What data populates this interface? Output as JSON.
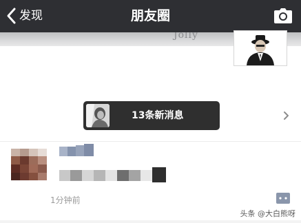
{
  "navbar": {
    "back_label": "发现",
    "title": "朋友圈"
  },
  "cover": {
    "text": "Jolly"
  },
  "notice": {
    "text": "13条新消息"
  },
  "post": {
    "time": "1分钟前"
  },
  "watermark": "头条 @大白熊呀",
  "colors": {
    "navbar": "#2e2f33",
    "notice_bg": "#2f2f2f",
    "comment_button": "#8a96ab",
    "time_text": "#9b9b9b"
  },
  "icons": {
    "back": "chevron-left-icon",
    "camera": "camera-icon",
    "notice_arrow": "chevron-right-icon",
    "comment": "comment-icon"
  }
}
